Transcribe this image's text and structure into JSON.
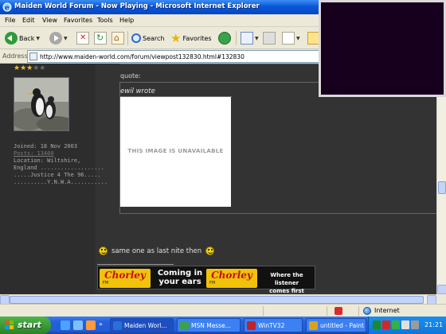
{
  "window": {
    "title": "Maiden World Forum - Now Playing - Microsoft Internet Explorer"
  },
  "menu": [
    "File",
    "Edit",
    "View",
    "Favorites",
    "Tools",
    "Help"
  ],
  "toolbar": {
    "back_label": "Back",
    "search_label": "Search",
    "favorites_label": "Favorites"
  },
  "address": {
    "label": "Address",
    "url": "http://www.maiden-world.com/forum/viewpost132830.html#132830"
  },
  "user": {
    "stars_on": "★★★",
    "stars_off": "★★",
    "joined": "Joined: 18 Nov 2003",
    "posts": "Posts: 13460",
    "location": "Location: Wiltshire,",
    "location2": "England ...................",
    "sig1": ".....Justice 4 The 96.....",
    "sig2": "..........Y.N.W.A..........."
  },
  "post": {
    "quote_label": "quote:",
    "quote_author": "ewil wrote",
    "image_unavailable": "THIS IMAGE IS UNAVAILABLE",
    "message": "same one as last nite then"
  },
  "banner": {
    "brand": "Chorley",
    "fm": "FM",
    "slogan1_line1": "Coming in",
    "slogan1_line2": "your ears",
    "slogan2_line1": "Where the listener",
    "slogan2_line2": "comes first"
  },
  "status": {
    "zone": "Internet"
  },
  "taskbar": {
    "start_label": "start",
    "tasks": [
      {
        "label": "Maiden Worl...",
        "icon_color": "#2b6fd8"
      },
      {
        "label": "MSN Messe...",
        "icon_color": "#3aa34a"
      },
      {
        "label": "WinTV32",
        "icon_color": "#c0232a"
      },
      {
        "label": "untitled - Paint",
        "icon_color": "#d9a21e"
      }
    ],
    "clock": "21:21"
  },
  "colors": {
    "forum_bg": "#333333",
    "chorley_yellow": "#f1c20a",
    "chorley_red": "#c21018",
    "xp_blue": "#0a58d8"
  }
}
